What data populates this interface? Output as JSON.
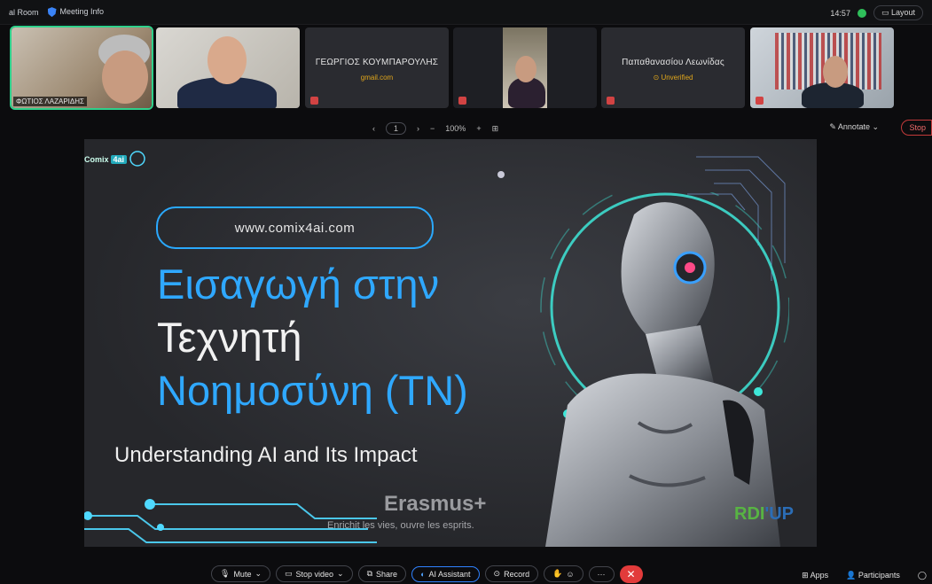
{
  "topbar": {
    "room_label": "al Room",
    "meeting_info": "Meeting Info",
    "time": "14:57",
    "layout_label": "Layout"
  },
  "participants": [
    {
      "name": "ΦΩΤΙΟΣ ΛΑΖΑΡΙΔΗΣ"
    },
    {
      "name": ""
    },
    {
      "name": "ΓΕΩΡΓΙΟΣ ΚΟΥΜΠΑΡΟΥΛΗΣ",
      "sub": "gmail.com"
    },
    {
      "name": ""
    },
    {
      "name": "Παπαθανασίου Λεωνίδας",
      "sub": "Unverified"
    },
    {
      "name": ""
    }
  ],
  "pagenav": {
    "page": "1",
    "zoom": "100%",
    "annotate": "Annotate",
    "stop": "Stop"
  },
  "slide": {
    "logo": "Comix",
    "logo_badge": "4ai",
    "url": "www.comix4ai.com",
    "title_line1": "Εισαγωγή στην",
    "title_line2": "Τεχνητή",
    "title_line3": "Νοημοσύνη (ΤΝ)",
    "subtitle": "Understanding AI and Its Impact",
    "erasmus": "Erasmus+",
    "erasmus_tagline": "Enrichit les vies, ouvre les esprits.",
    "rdi_a": "RDI",
    "rdi_b": "'UP"
  },
  "toolbar": {
    "mute": "Mute",
    "stop_video": "Stop video",
    "share": "Share",
    "ai_assistant": "AI Assistant",
    "record": "Record",
    "more": "···",
    "apps": "Apps",
    "participants": "Participants"
  },
  "colors": {
    "accent_blue": "#2fa8ff",
    "end_red": "#e23b3b",
    "active_green": "#2fd08b"
  }
}
